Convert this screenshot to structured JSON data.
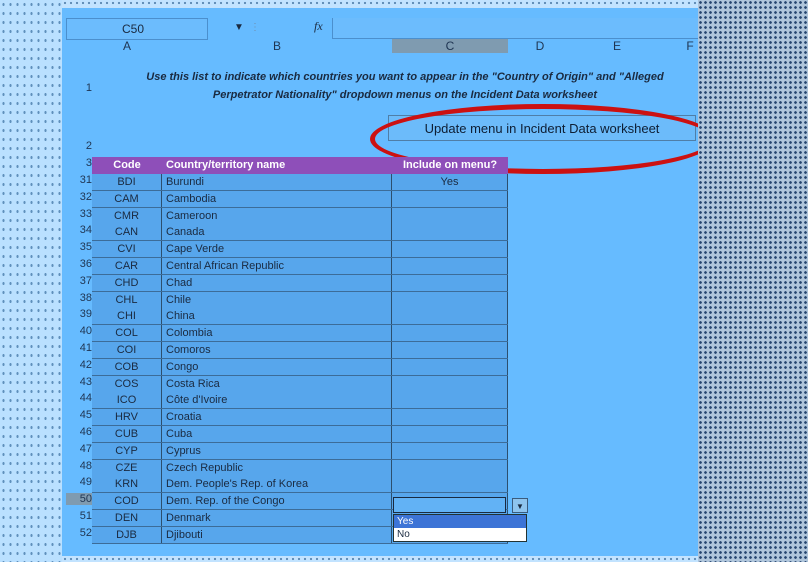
{
  "formula_bar": {
    "name_box": "C50",
    "fx_label": "fx"
  },
  "column_headers": [
    "A",
    "B",
    "C",
    "D",
    "E",
    "F"
  ],
  "instructions": {
    "line1": "Use this list to indicate which countries you want to appear in the \"Country of Origin\" and \"Alleged",
    "line2": "Perpetrator Nationality\" dropdown menus on the Incident Data worksheet"
  },
  "update_button": {
    "label": "Update menu in Incident Data worksheet"
  },
  "table": {
    "headers": {
      "code": "Code",
      "name": "Country/territory name",
      "include": "Include on menu?"
    },
    "rows": [
      {
        "row": "31",
        "code": "BDI",
        "name": "Burundi",
        "include": "Yes"
      },
      {
        "row": "32",
        "code": "CAM",
        "name": "Cambodia",
        "include": ""
      },
      {
        "row": "33",
        "code": "CMR",
        "name": "Cameroon",
        "include": ""
      },
      {
        "row": "34",
        "code": "CAN",
        "name": "Canada",
        "include": ""
      },
      {
        "row": "35",
        "code": "CVI",
        "name": "Cape Verde",
        "include": ""
      },
      {
        "row": "36",
        "code": "CAR",
        "name": "Central African Republic",
        "include": ""
      },
      {
        "row": "37",
        "code": "CHD",
        "name": "Chad",
        "include": ""
      },
      {
        "row": "38",
        "code": "CHL",
        "name": "Chile",
        "include": ""
      },
      {
        "row": "39",
        "code": "CHI",
        "name": "China",
        "include": ""
      },
      {
        "row": "40",
        "code": "COL",
        "name": "Colombia",
        "include": ""
      },
      {
        "row": "41",
        "code": "COI",
        "name": "Comoros",
        "include": ""
      },
      {
        "row": "42",
        "code": "COB",
        "name": "Congo",
        "include": ""
      },
      {
        "row": "43",
        "code": "COS",
        "name": "Costa Rica",
        "include": ""
      },
      {
        "row": "44",
        "code": "ICO",
        "name": "Côte d'Ivoire",
        "include": ""
      },
      {
        "row": "45",
        "code": "HRV",
        "name": "Croatia",
        "include": ""
      },
      {
        "row": "46",
        "code": "CUB",
        "name": "Cuba",
        "include": ""
      },
      {
        "row": "47",
        "code": "CYP",
        "name": "Cyprus",
        "include": ""
      },
      {
        "row": "48",
        "code": "CZE",
        "name": "Czech Republic",
        "include": ""
      },
      {
        "row": "49",
        "code": "KRN",
        "name": "Dem. People's Rep. of Korea",
        "include": ""
      },
      {
        "row": "50",
        "code": "COD",
        "name": "Dem. Rep. of the Congo",
        "include": ""
      },
      {
        "row": "51",
        "code": "DEN",
        "name": "Denmark",
        "include": ""
      },
      {
        "row": "52",
        "code": "DJB",
        "name": "Djibouti",
        "include": ""
      }
    ]
  },
  "row_labels": {
    "r1": "1",
    "r2": "2",
    "r3": "3"
  },
  "dropdown": {
    "options": [
      "Yes",
      "No"
    ]
  }
}
